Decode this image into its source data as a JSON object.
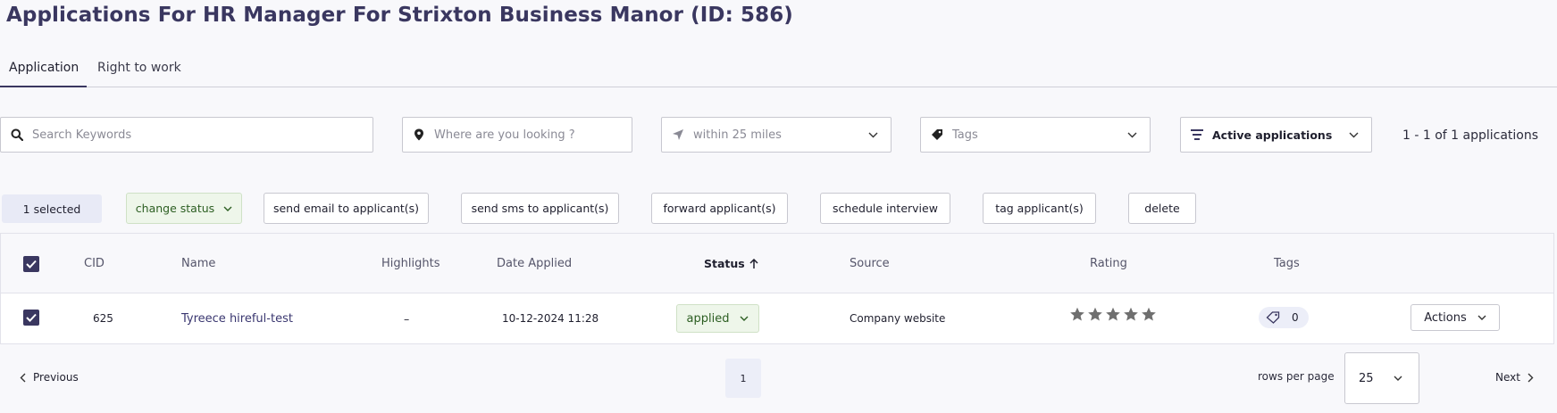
{
  "page": {
    "title": "Applications For HR Manager For Strixton Business Manor (ID: 586)"
  },
  "tabs": [
    {
      "label": "Application",
      "active": true
    },
    {
      "label": "Right to work",
      "active": false
    }
  ],
  "filters": {
    "search_placeholder": "Search Keywords",
    "location_placeholder": "Where are you looking ?",
    "distance_value": "within 25 miles",
    "tags_placeholder": "Tags",
    "status_filter_value": "Active applications",
    "results_count": "1 - 1 of 1 applications"
  },
  "bulk_actions": {
    "selected_label": "1 selected",
    "change_status": "change status",
    "send_email": "send email to applicant(s)",
    "send_sms": "send sms to applicant(s)",
    "forward": "forward applicant(s)",
    "schedule": "schedule interview",
    "tag": "tag applicant(s)",
    "delete": "delete"
  },
  "table": {
    "headers": {
      "cid": "CID",
      "name": "Name",
      "highlights": "Highlights",
      "date_applied": "Date Applied",
      "status": "Status",
      "source": "Source",
      "rating": "Rating",
      "tags": "Tags"
    },
    "rows": [
      {
        "selected": true,
        "cid": "625",
        "name": "Tyreece hireful-test",
        "highlights": "–",
        "date_applied": "10-12-2024 11:28",
        "status": "applied",
        "source": "Company website",
        "rating": 0,
        "rating_max": 5,
        "tags_count": "0",
        "actions_label": "Actions"
      }
    ]
  },
  "pagination": {
    "previous": "Previous",
    "current_page": "1",
    "rows_per_page_label": "rows per page",
    "rows_per_page_value": "25",
    "next": "Next"
  },
  "colors": {
    "accent": "#3a3760",
    "status_bg": "#eef6ea",
    "status_text": "#2c5e22",
    "star": "#6f6f6f"
  }
}
